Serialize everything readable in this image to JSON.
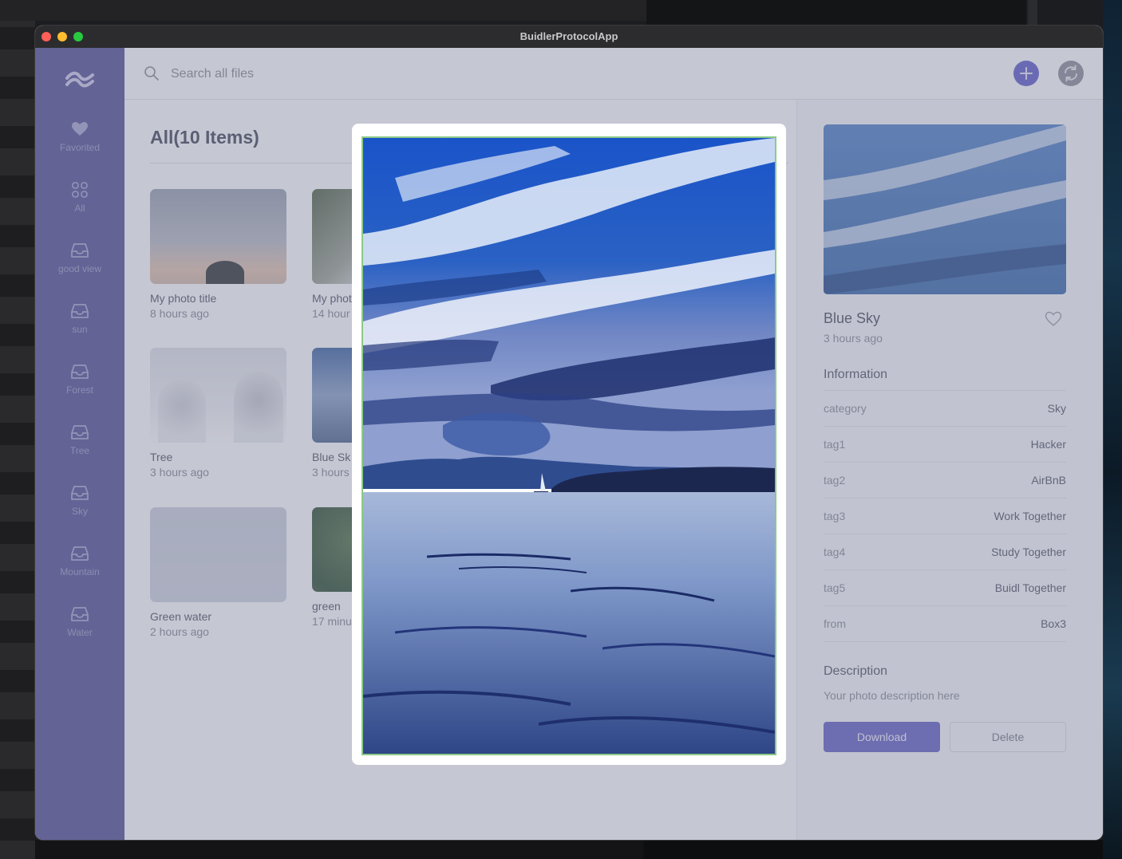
{
  "window": {
    "title": "BuidlerProtocolApp"
  },
  "colors": {
    "sidebar": "#5d5c9b",
    "accent": "#6866c9",
    "modal_border": "#8cc987"
  },
  "sidebar": {
    "logo_icon": "wave-logo-icon",
    "items": [
      {
        "label": "Favorited",
        "icon": "heart-icon"
      },
      {
        "label": "All",
        "icon": "grid-icon"
      },
      {
        "label": "good view",
        "icon": "inbox-icon"
      },
      {
        "label": "sun",
        "icon": "inbox-icon"
      },
      {
        "label": "Forest",
        "icon": "inbox-icon"
      },
      {
        "label": "Tree",
        "icon": "inbox-icon"
      },
      {
        "label": "Sky",
        "icon": "inbox-icon"
      },
      {
        "label": "Mountain",
        "icon": "inbox-icon"
      },
      {
        "label": "Water",
        "icon": "inbox-icon"
      }
    ]
  },
  "search": {
    "placeholder": "Search all files"
  },
  "toolbar": {
    "add_icon": "plus-icon",
    "sync_icon": "sync-icon"
  },
  "main": {
    "title": "All(10 Items)",
    "cards": [
      {
        "title": "My photo title",
        "time": "8 hours ago"
      },
      {
        "title": "My phot",
        "time": "14 hour"
      },
      {
        "title": "Tree",
        "time": "3 hours ago"
      },
      {
        "title": "Blue Sk",
        "time": "3 hours"
      },
      {
        "title": "Green water",
        "time": "2 hours ago"
      },
      {
        "title": "green",
        "time": "17 minu"
      }
    ]
  },
  "details": {
    "title": "Blue Sky",
    "time": "3 hours ago",
    "info_heading": "Information",
    "info": [
      {
        "key": "category",
        "value": "Sky"
      },
      {
        "key": "tag1",
        "value": "Hacker"
      },
      {
        "key": "tag2",
        "value": "AirBnB"
      },
      {
        "key": "tag3",
        "value": "Work Together"
      },
      {
        "key": "tag4",
        "value": "Study Together"
      },
      {
        "key": "tag5",
        "value": "Buidl Together"
      },
      {
        "key": "from",
        "value": "Box3"
      }
    ],
    "description_heading": "Description",
    "description": "Your photo description here",
    "download_label": "Download",
    "delete_label": "Delete"
  }
}
